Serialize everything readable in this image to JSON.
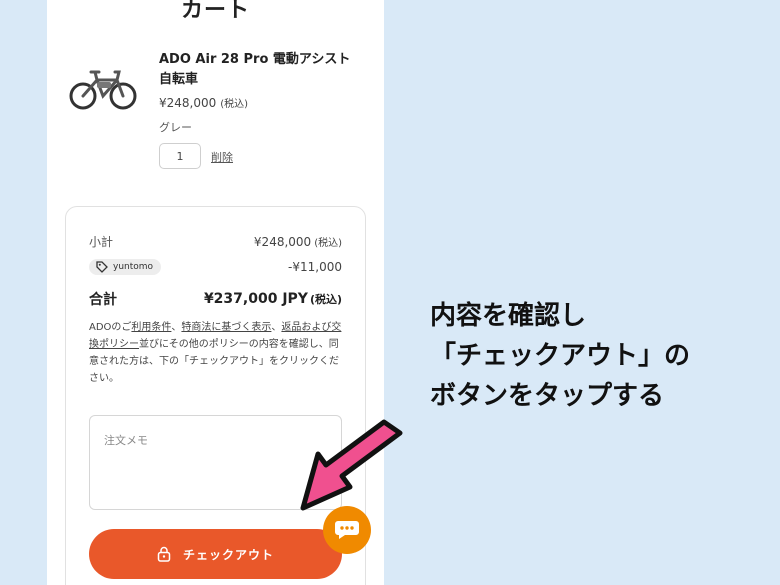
{
  "cart": {
    "title": "カート",
    "product": {
      "name": "ADO Air 28 Pro 電動アシスト自転車",
      "price": "¥248,000",
      "price_tax": "(税込)",
      "variant": "グレー",
      "quantity": "1",
      "delete_label": "削除",
      "image_icon": "e-bike-image"
    }
  },
  "summary": {
    "subtotal_label": "小計",
    "subtotal_value": "¥248,000",
    "subtotal_tax": "(税込)",
    "coupon_code": "yuntomo",
    "coupon_icon": "tag-icon",
    "discount_value": "-¥11,000",
    "total_label": "合計",
    "total_value": "¥237,000 JPY",
    "total_tax": "(税込)",
    "policy": {
      "p1": "ADOのご",
      "link1": "利用条件",
      "p2": "、",
      "link2": "特商法に基づく表示",
      "p3": "、",
      "link3": "返品および交換ポリシー",
      "p4": "並びにその他のポリシーの内容を確認し、同意された方は、下の「チェックアウト」をクリックください。"
    },
    "memo_placeholder": "注文メモ",
    "checkout_label": "チェックアウト"
  },
  "chat": {
    "icon": "chat-icon"
  },
  "instruction": {
    "line1": "内容を確認し",
    "line2": "「チェックアウト」の",
    "line3": "ボタンをタップする"
  },
  "colors": {
    "background": "#d9e9f7",
    "checkout": "#e9582a",
    "chat": "#f08a00",
    "arrow": "#f0508f"
  }
}
